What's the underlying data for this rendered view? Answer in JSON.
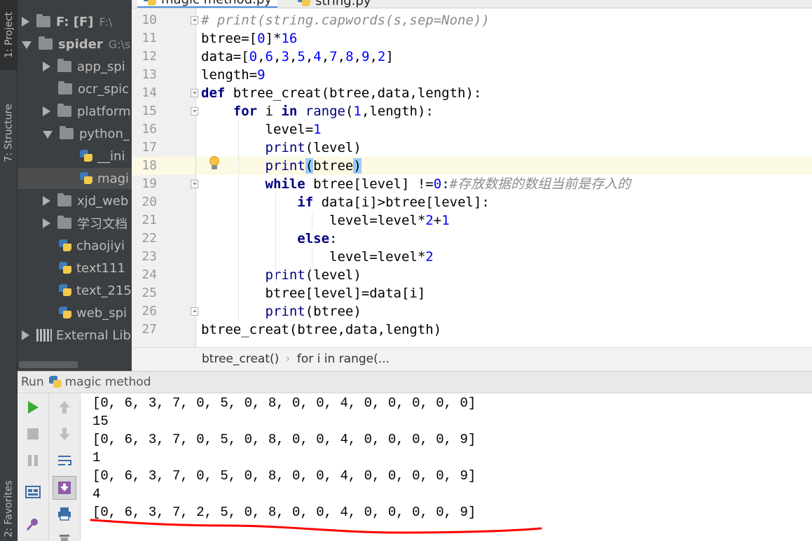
{
  "tool_strip": {
    "project_tab": "1: Project",
    "structure_tab": "7: Structure",
    "favorites_tab": "2: Favorites"
  },
  "project_tree": [
    {
      "label": "F: [F]",
      "dim": "F:\\",
      "arrow": "right",
      "icon": "folder",
      "bold": true
    },
    {
      "label": "spider",
      "dim": "G:\\s",
      "arrow": "down",
      "icon": "folder",
      "bold": true
    },
    {
      "label": "app_spi",
      "dim": "",
      "arrow": "right",
      "icon": "folder"
    },
    {
      "label": "ocr_spic",
      "dim": "",
      "arrow": "none",
      "icon": "folder"
    },
    {
      "label": "platform",
      "dim": "",
      "arrow": "right",
      "icon": "folder"
    },
    {
      "label": "python_",
      "dim": "",
      "arrow": "down",
      "icon": "folder"
    },
    {
      "label": "__ini",
      "dim": "",
      "arrow": "none",
      "icon": "py"
    },
    {
      "label": "magi",
      "dim": "",
      "arrow": "none",
      "icon": "py",
      "selected": true
    },
    {
      "label": "xjd_web",
      "dim": "",
      "arrow": "right",
      "icon": "folder"
    },
    {
      "label": "学习文档",
      "dim": "",
      "arrow": "right",
      "icon": "folder"
    },
    {
      "label": "chaojiyi",
      "dim": "",
      "arrow": "none",
      "icon": "py"
    },
    {
      "label": "text111",
      "dim": "",
      "arrow": "none",
      "icon": "py"
    },
    {
      "label": "text_215",
      "dim": "",
      "arrow": "none",
      "icon": "py"
    },
    {
      "label": "web_spi",
      "dim": "",
      "arrow": "none",
      "icon": "py"
    },
    {
      "label": "External Lib",
      "dim": "",
      "arrow": "right",
      "icon": "lib"
    }
  ],
  "editor_tabs": [
    "magic method.py",
    "string.py"
  ],
  "code_lines": [
    {
      "n": "10",
      "tokens": [
        [
          "cmt",
          "# print(string.capwords(s,sep=None))"
        ]
      ]
    },
    {
      "n": "11",
      "tokens": [
        [
          "",
          "btree=["
        ],
        [
          "num",
          "0"
        ],
        [
          "",
          "]*"
        ],
        [
          "num",
          "16"
        ]
      ]
    },
    {
      "n": "12",
      "tokens": [
        [
          "",
          "data=["
        ],
        [
          "num",
          "0"
        ],
        [
          "",
          ","
        ],
        [
          "num",
          "6"
        ],
        [
          "",
          ","
        ],
        [
          "num",
          "3"
        ],
        [
          "",
          ","
        ],
        [
          "num",
          "5"
        ],
        [
          "",
          ","
        ],
        [
          "num",
          "4"
        ],
        [
          "",
          ","
        ],
        [
          "num",
          "7"
        ],
        [
          "",
          ","
        ],
        [
          "num",
          "8"
        ],
        [
          "",
          ","
        ],
        [
          "num",
          "9"
        ],
        [
          "",
          ","
        ],
        [
          "num",
          "2"
        ],
        [
          "",
          "]"
        ]
      ]
    },
    {
      "n": "13",
      "tokens": [
        [
          "",
          "length="
        ],
        [
          "num",
          "9"
        ]
      ]
    },
    {
      "n": "14",
      "tokens": [
        [
          "kw",
          "def"
        ],
        [
          "",
          " btree_creat(btree,data,length):"
        ]
      ]
    },
    {
      "n": "15",
      "tokens": [
        [
          "",
          "    "
        ],
        [
          "kw",
          "for"
        ],
        [
          "",
          " i "
        ],
        [
          "kw",
          "in"
        ],
        [
          "",
          " "
        ],
        [
          "bi",
          "range"
        ],
        [
          "",
          "("
        ],
        [
          "num",
          "1"
        ],
        [
          "",
          ",length):"
        ]
      ]
    },
    {
      "n": "16",
      "tokens": [
        [
          "",
          "        level="
        ],
        [
          "num",
          "1"
        ]
      ]
    },
    {
      "n": "17",
      "tokens": [
        [
          "",
          "        "
        ],
        [
          "bi",
          "print"
        ],
        [
          "",
          "(level)"
        ]
      ]
    },
    {
      "n": "18",
      "tokens": [
        [
          "",
          "        "
        ],
        [
          "bi",
          "print"
        ],
        [
          "bracket",
          "("
        ],
        [
          "",
          "btree"
        ],
        [
          "bracket",
          ")"
        ]
      ]
    },
    {
      "n": "19",
      "tokens": [
        [
          "",
          "        "
        ],
        [
          "kw",
          "while"
        ],
        [
          "",
          " btree[level] !="
        ],
        [
          "num",
          "0"
        ],
        [
          "",
          ":"
        ],
        [
          "cmt",
          "#存放数据的数组当前是存入的"
        ]
      ]
    },
    {
      "n": "20",
      "tokens": [
        [
          "",
          "            "
        ],
        [
          "kw",
          "if"
        ],
        [
          "",
          " data[i]>btree[level]:"
        ]
      ]
    },
    {
      "n": "21",
      "tokens": [
        [
          "",
          "                level=level*"
        ],
        [
          "num",
          "2"
        ],
        [
          "",
          "+"
        ],
        [
          "num",
          "1"
        ]
      ]
    },
    {
      "n": "22",
      "tokens": [
        [
          "",
          "            "
        ],
        [
          "kw",
          "else"
        ],
        [
          "",
          ":"
        ]
      ]
    },
    {
      "n": "23",
      "tokens": [
        [
          "",
          "                level=level*"
        ],
        [
          "num",
          "2"
        ]
      ]
    },
    {
      "n": "24",
      "tokens": [
        [
          "",
          "        "
        ],
        [
          "bi",
          "print"
        ],
        [
          "",
          "(level)"
        ]
      ]
    },
    {
      "n": "25",
      "tokens": [
        [
          "",
          "        btree[level]=data[i]"
        ]
      ]
    },
    {
      "n": "26",
      "tokens": [
        [
          "",
          "        "
        ],
        [
          "bi",
          "print"
        ],
        [
          "",
          "(btree)"
        ]
      ]
    },
    {
      "n": "27",
      "tokens": [
        [
          "",
          "btree_creat(btree,data,length)"
        ]
      ]
    }
  ],
  "breadcrumb": {
    "func": "btree_creat()",
    "sep": "›",
    "loop": "for i in range(..."
  },
  "run": {
    "label": "Run",
    "config": "magic method",
    "output": [
      "[0, 6, 3, 7, 0, 5, 0, 8, 0, 0, 4, 0, 0, 0, 0, 0]",
      "15",
      "[0, 6, 3, 7, 0, 5, 0, 8, 0, 0, 4, 0, 0, 0, 0, 9]",
      "1",
      "[0, 6, 3, 7, 0, 5, 0, 8, 0, 0, 4, 0, 0, 0, 0, 9]",
      "4",
      "[0, 6, 3, 7, 2, 5, 0, 8, 0, 0, 4, 0, 0, 0, 0, 9]"
    ]
  },
  "colors": {
    "keyword": "#000080",
    "number": "#0000ff",
    "comment": "#8c8c8c",
    "annotation_underline": "#ff0000",
    "run_green": "#3aaa35"
  }
}
